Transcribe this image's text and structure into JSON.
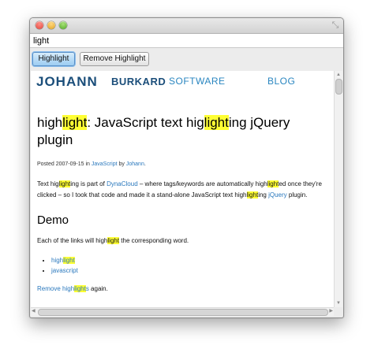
{
  "window": {
    "search_value": "light"
  },
  "toolbar": {
    "highlight_label": "Highlight",
    "remove_label": "Remove Highlight"
  },
  "site": {
    "logo_first": "JOHANN",
    "logo_last": "BURKARD",
    "nav": [
      "SOFTWARE",
      "BLOG"
    ]
  },
  "post": {
    "title": [
      "high",
      "light",
      ": JavaScript text hig",
      "light",
      "ing jQuery plugin"
    ],
    "meta": {
      "posted_prefix": "Posted 2007-09-15 in ",
      "category": "JavaScript",
      "by_text": " by ",
      "author": "Johann",
      "end": "."
    },
    "intro": {
      "t1": "Text hig",
      "h1": "light",
      "t2": "ing is part of ",
      "link_dynacloud": "DynaCloud",
      "t3": " – where tags/keywords are automatically high",
      "h2": "light",
      "t4": "ed once they're clicked – so I took that code and made it a stand-alone JavaScript text high",
      "h3": "light",
      "t5": "ing ",
      "link_jquery": "jQuery",
      "t6": " plugin."
    },
    "demo_heading": "Demo",
    "demo_text": {
      "t1": "Each of the links will high",
      "h1": "light",
      "t2": " the corresponding word."
    },
    "demo_links": [
      {
        "pre": "high",
        "hl": "light",
        "post": ""
      },
      {
        "pre": "javascript",
        "hl": "",
        "post": ""
      }
    ],
    "remove": {
      "link_pre": "Remove high",
      "link_hl": "light",
      "link_post": "s",
      "tail": " again."
    }
  }
}
